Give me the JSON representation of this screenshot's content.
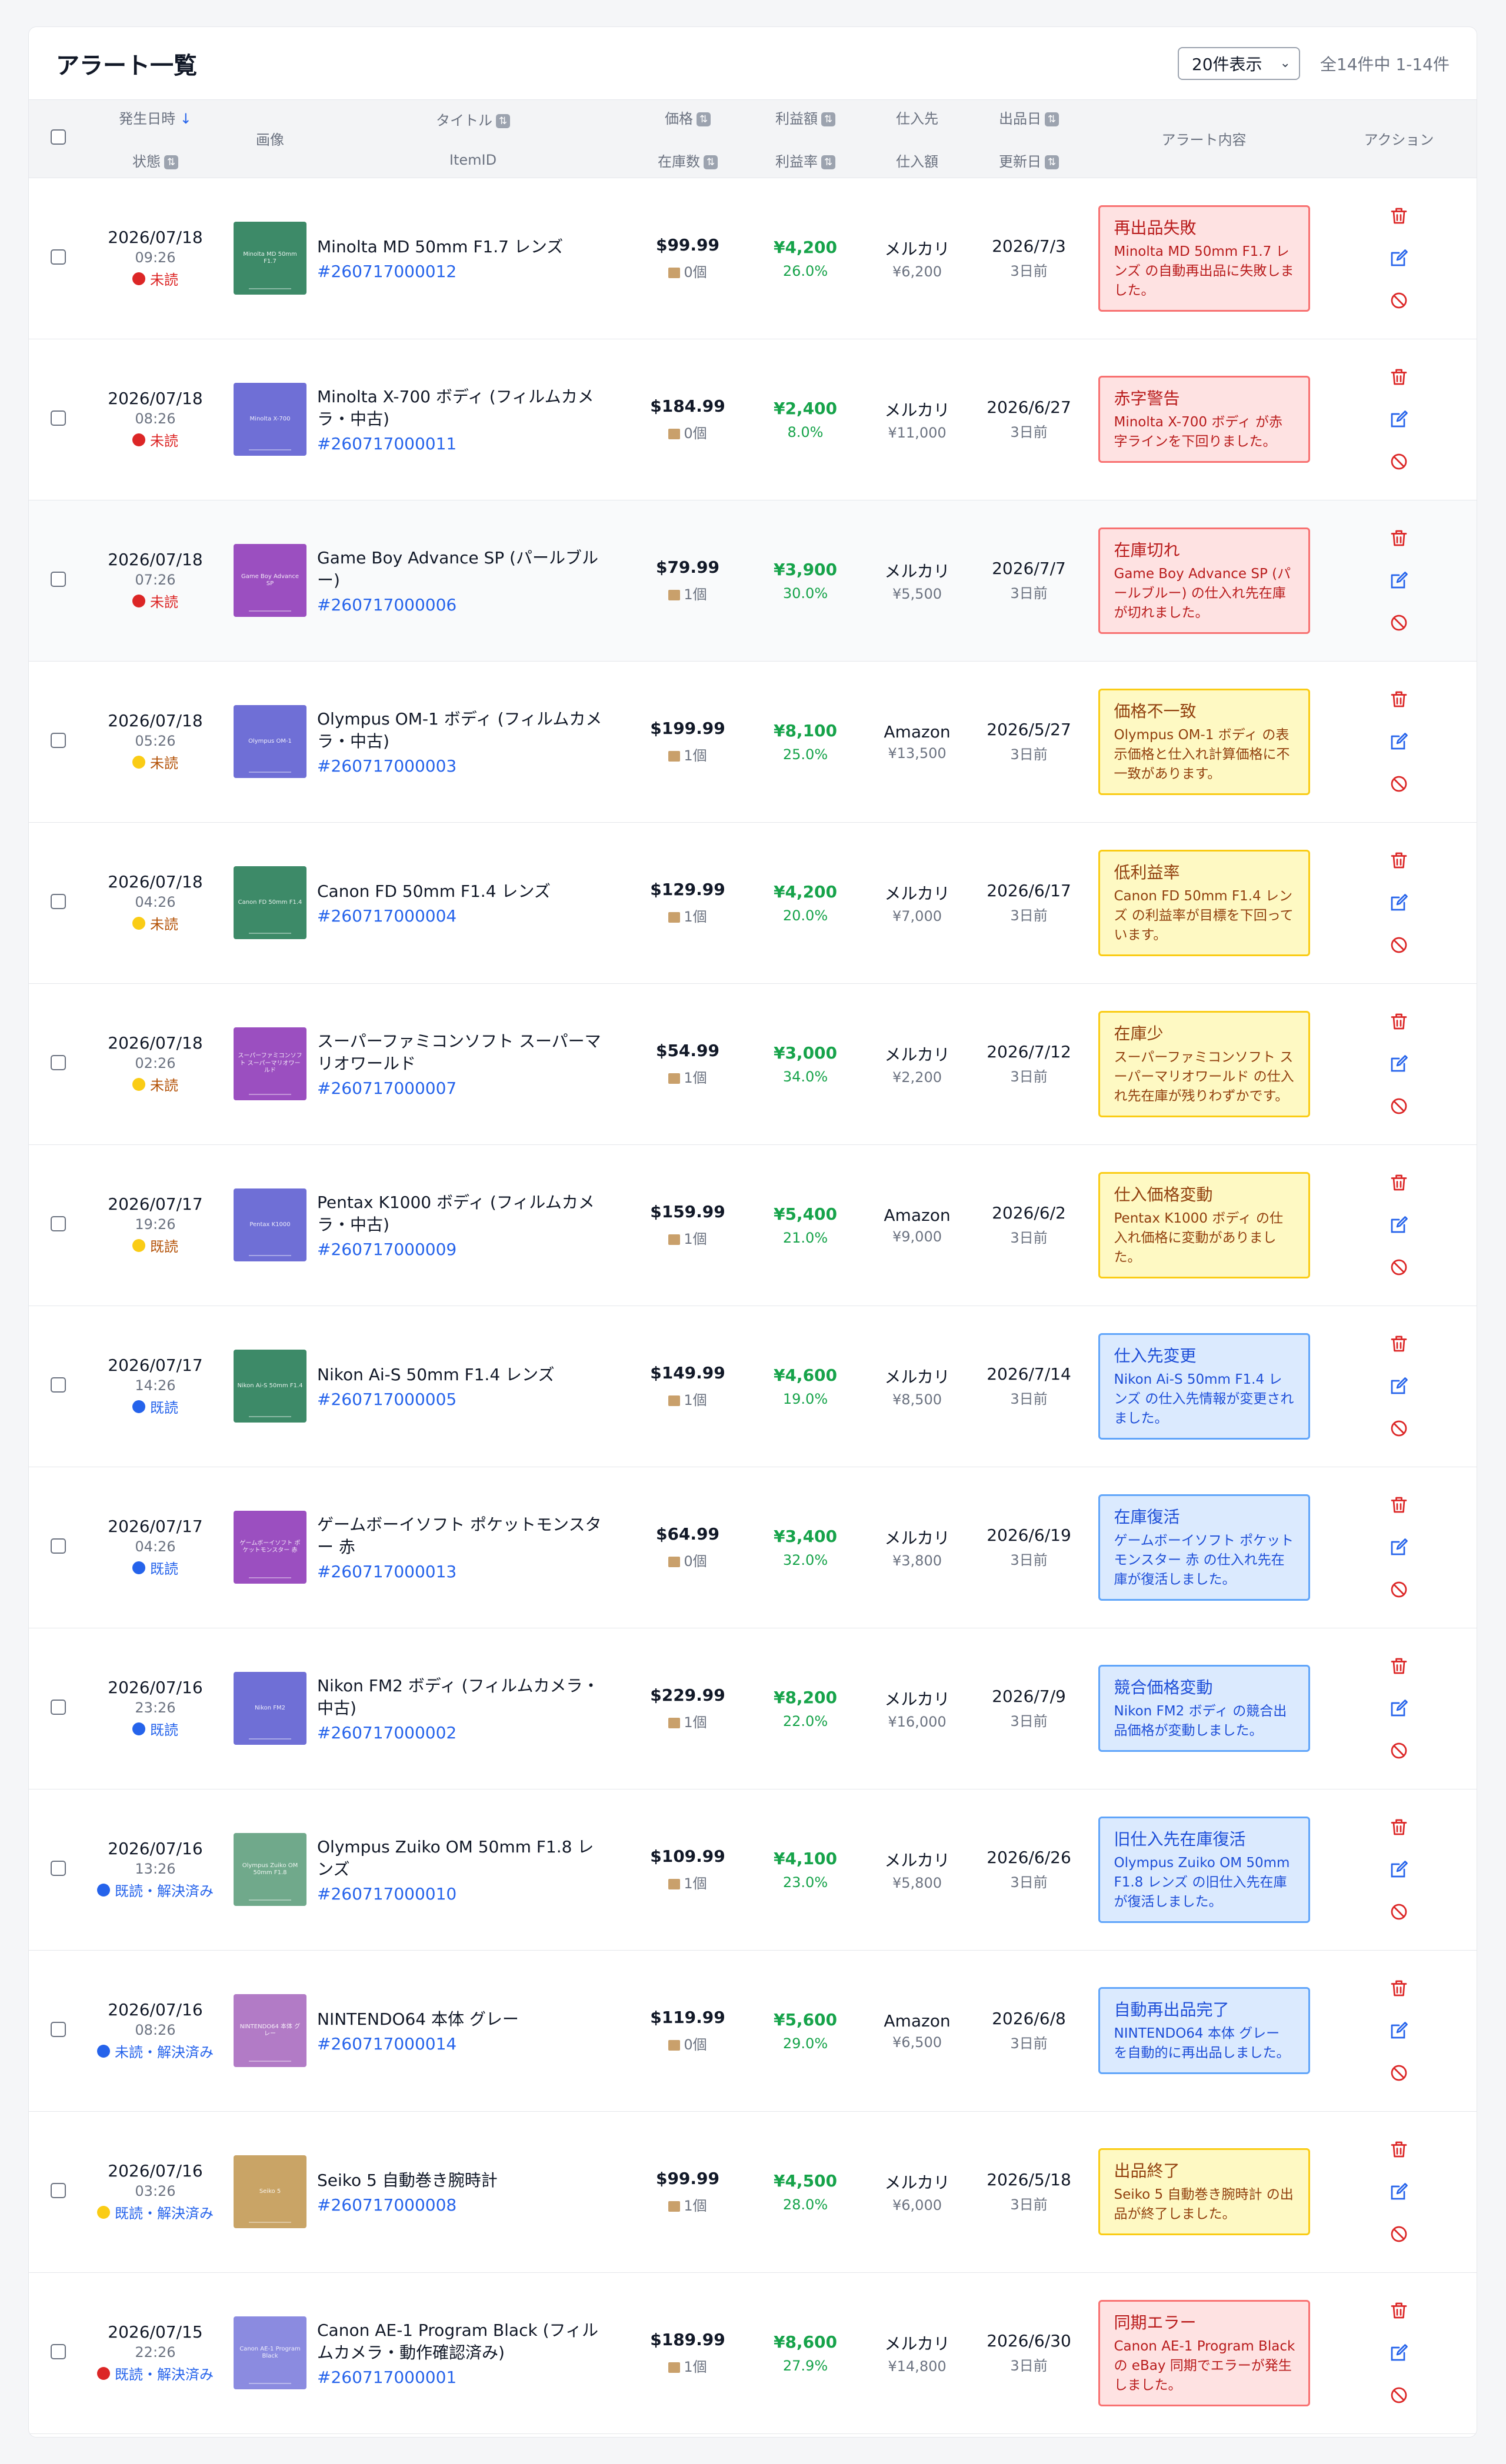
{
  "panel": {
    "title": "アラート一覧",
    "per_page": "20件表示",
    "count": "全14件中 1-14件"
  },
  "columns": {
    "occurred": "発生日時",
    "occurred_sort": "↓",
    "status": "状態",
    "image": "画像",
    "title": "タイトル",
    "itemid": "ItemID",
    "price": "価格",
    "stock": "在庫数",
    "profit": "利益額",
    "rate": "利益率",
    "source": "仕入先",
    "cost": "仕入額",
    "listed": "出品日",
    "updated": "更新日",
    "alert": "アラート内容",
    "action": "アクション"
  },
  "colors": {
    "red": "#dc2626",
    "yellow": "#facc15",
    "blue": "#2563eb",
    "unread_text": "#dc2626",
    "yellow_text": "#b45309",
    "blue_text": "#2563eb"
  },
  "rows": [
    {
      "date": "2026/07/18",
      "time": "09:26",
      "status": "未読",
      "dot": "red",
      "thumb_color": "#3d8a68",
      "thumb_label": "Minolta MD 50mm F1.7",
      "title": "Minolta MD 50mm F1.7 レンズ",
      "itemid": "#260717000012",
      "price": "$99.99",
      "stock": "0個",
      "profit": "¥4,200",
      "rate": "26.0%",
      "source": "メルカリ",
      "cost": "¥6,200",
      "listed": "2026/7/3",
      "updated": "3日前",
      "alert_level": "red",
      "alert_title": "再出品失敗",
      "alert_body": "Minolta MD 50mm F1.7 レンズ の自動再出品に失敗しました。",
      "highlight": false
    },
    {
      "date": "2026/07/18",
      "time": "08:26",
      "status": "未読",
      "dot": "red",
      "thumb_color": "#6f6fd6",
      "thumb_label": "Minolta X-700",
      "title": "Minolta X-700 ボディ (フィルムカメラ・中古)",
      "itemid": "#260717000011",
      "price": "$184.99",
      "stock": "0個",
      "profit": "¥2,400",
      "rate": "8.0%",
      "source": "メルカリ",
      "cost": "¥11,000",
      "listed": "2026/6/27",
      "updated": "3日前",
      "alert_level": "red",
      "alert_title": "赤字警告",
      "alert_body": "Minolta X-700 ボディ が赤字ラインを下回りました。",
      "highlight": false
    },
    {
      "date": "2026/07/18",
      "time": "07:26",
      "status": "未読",
      "dot": "red",
      "thumb_color": "#9b4fc0",
      "thumb_label": "Game Boy Advance SP",
      "title": "Game Boy Advance SP (パールブルー)",
      "itemid": "#260717000006",
      "price": "$79.99",
      "stock": "1個",
      "profit": "¥3,900",
      "rate": "30.0%",
      "source": "メルカリ",
      "cost": "¥5,500",
      "listed": "2026/7/7",
      "updated": "3日前",
      "alert_level": "red",
      "alert_title": "在庫切れ",
      "alert_body": "Game Boy Advance SP (パールブルー) の仕入れ先在庫が切れました。",
      "highlight": true
    },
    {
      "date": "2026/07/18",
      "time": "05:26",
      "status": "未読",
      "dot": "yellow",
      "thumb_color": "#6f6fd6",
      "thumb_label": "Olympus OM-1",
      "title": "Olympus OM-1 ボディ (フィルムカメラ・中古)",
      "itemid": "#260717000003",
      "price": "$199.99",
      "stock": "1個",
      "profit": "¥8,100",
      "rate": "25.0%",
      "source": "Amazon",
      "cost": "¥13,500",
      "listed": "2026/5/27",
      "updated": "3日前",
      "alert_level": "yellow",
      "alert_title": "価格不一致",
      "alert_body": "Olympus OM-1 ボディ の表示価格と仕入れ計算価格に不一致があります。",
      "highlight": false
    },
    {
      "date": "2026/07/18",
      "time": "04:26",
      "status": "未読",
      "dot": "yellow",
      "thumb_color": "#3d8a68",
      "thumb_label": "Canon FD 50mm F1.4",
      "title": "Canon FD 50mm F1.4 レンズ",
      "itemid": "#260717000004",
      "price": "$129.99",
      "stock": "1個",
      "profit": "¥4,200",
      "rate": "20.0%",
      "source": "メルカリ",
      "cost": "¥7,000",
      "listed": "2026/6/17",
      "updated": "3日前",
      "alert_level": "yellow",
      "alert_title": "低利益率",
      "alert_body": "Canon FD 50mm F1.4 レンズ の利益率が目標を下回っています。",
      "highlight": false
    },
    {
      "date": "2026/07/18",
      "time": "02:26",
      "status": "未読",
      "dot": "yellow",
      "thumb_color": "#9b4fc0",
      "thumb_label": "スーパーファミコンソフト スーパーマリオワールド",
      "title": "スーパーファミコンソフト スーパーマリオワールド",
      "itemid": "#260717000007",
      "price": "$54.99",
      "stock": "1個",
      "profit": "¥3,000",
      "rate": "34.0%",
      "source": "メルカリ",
      "cost": "¥2,200",
      "listed": "2026/7/12",
      "updated": "3日前",
      "alert_level": "yellow",
      "alert_title": "在庫少",
      "alert_body": "スーパーファミコンソフト スーパーマリオワールド の仕入れ先在庫が残りわずかです。",
      "highlight": false
    },
    {
      "date": "2026/07/17",
      "time": "19:26",
      "status": "既読",
      "dot": "yellow",
      "thumb_color": "#6f6fd6",
      "thumb_label": "Pentax K1000",
      "title": "Pentax K1000 ボディ (フィルムカメラ・中古)",
      "itemid": "#260717000009",
      "price": "$159.99",
      "stock": "1個",
      "profit": "¥5,400",
      "rate": "21.0%",
      "source": "Amazon",
      "cost": "¥9,000",
      "listed": "2026/6/2",
      "updated": "3日前",
      "alert_level": "yellow",
      "alert_title": "仕入価格変動",
      "alert_body": "Pentax K1000 ボディ の仕入れ価格に変動がありました。",
      "highlight": false
    },
    {
      "date": "2026/07/17",
      "time": "14:26",
      "status": "既読",
      "dot": "blue",
      "thumb_color": "#3d8a68",
      "thumb_label": "Nikon Ai-S 50mm F1.4",
      "title": "Nikon Ai-S 50mm F1.4 レンズ",
      "itemid": "#260717000005",
      "price": "$149.99",
      "stock": "1個",
      "profit": "¥4,600",
      "rate": "19.0%",
      "source": "メルカリ",
      "cost": "¥8,500",
      "listed": "2026/7/14",
      "updated": "3日前",
      "alert_level": "blue",
      "alert_title": "仕入先変更",
      "alert_body": "Nikon Ai-S 50mm F1.4 レンズ の仕入先情報が変更されました。",
      "highlight": false
    },
    {
      "date": "2026/07/17",
      "time": "04:26",
      "status": "既読",
      "dot": "blue",
      "thumb_color": "#9b4fc0",
      "thumb_label": "ゲームボーイソフト ポケットモンスター 赤",
      "title": "ゲームボーイソフト ポケットモンスター 赤",
      "itemid": "#260717000013",
      "price": "$64.99",
      "stock": "0個",
      "profit": "¥3,400",
      "rate": "32.0%",
      "source": "メルカリ",
      "cost": "¥3,800",
      "listed": "2026/6/19",
      "updated": "3日前",
      "alert_level": "blue",
      "alert_title": "在庫復活",
      "alert_body": "ゲームボーイソフト ポケットモンスター 赤 の仕入れ先在庫が復活しました。",
      "highlight": false
    },
    {
      "date": "2026/07/16",
      "time": "23:26",
      "status": "既読",
      "dot": "blue",
      "thumb_color": "#6f6fd6",
      "thumb_label": "Nikon FM2",
      "title": "Nikon FM2 ボディ (フィルムカメラ・中古)",
      "itemid": "#260717000002",
      "price": "$229.99",
      "stock": "1個",
      "profit": "¥8,200",
      "rate": "22.0%",
      "source": "メルカリ",
      "cost": "¥16,000",
      "listed": "2026/7/9",
      "updated": "3日前",
      "alert_level": "blue",
      "alert_title": "競合価格変動",
      "alert_body": "Nikon FM2 ボディ の競合出品価格が変動しました。",
      "highlight": false
    },
    {
      "date": "2026/07/16",
      "time": "13:26",
      "status": "既読・解決済み",
      "dot": "blue",
      "thumb_color": "#70a98b",
      "thumb_label": "Olympus Zuiko OM 50mm F1.8",
      "title": "Olympus Zuiko OM 50mm F1.8 レンズ",
      "itemid": "#260717000010",
      "price": "$109.99",
      "stock": "1個",
      "profit": "¥4,100",
      "rate": "23.0%",
      "source": "メルカリ",
      "cost": "¥5,800",
      "listed": "2026/6/26",
      "updated": "3日前",
      "alert_level": "blue",
      "alert_title": "旧仕入先在庫復活",
      "alert_body": "Olympus Zuiko OM 50mm F1.8 レンズ の旧仕入先在庫が復活しました。",
      "highlight": false
    },
    {
      "date": "2026/07/16",
      "time": "08:26",
      "status": "未読・解決済み",
      "dot": "blue",
      "thumb_color": "#b27bc6",
      "thumb_label": "NINTENDO64 本体 グレー",
      "title": "NINTENDO64 本体 グレー",
      "itemid": "#260717000014",
      "price": "$119.99",
      "stock": "0個",
      "profit": "¥5,600",
      "rate": "29.0%",
      "source": "Amazon",
      "cost": "¥6,500",
      "listed": "2026/6/8",
      "updated": "3日前",
      "alert_level": "blue",
      "alert_title": "自動再出品完了",
      "alert_body": "NINTENDO64 本体 グレー を自動的に再出品しました。",
      "highlight": false
    },
    {
      "date": "2026/07/16",
      "time": "03:26",
      "status": "既読・解決済み",
      "dot": "yellow",
      "thumb_color": "#c9a466",
      "thumb_label": "Seiko 5",
      "title": "Seiko 5 自動巻き腕時計",
      "itemid": "#260717000008",
      "price": "$99.99",
      "stock": "1個",
      "profit": "¥4,500",
      "rate": "28.0%",
      "source": "メルカリ",
      "cost": "¥6,000",
      "listed": "2026/5/18",
      "updated": "3日前",
      "alert_level": "yellow",
      "alert_title": "出品終了",
      "alert_body": "Seiko 5 自動巻き腕時計 の出品が終了しました。",
      "highlight": false
    },
    {
      "date": "2026/07/15",
      "time": "22:26",
      "status": "既読・解決済み",
      "dot": "red",
      "thumb_color": "#8b8be0",
      "thumb_label": "Canon AE-1 Program Black",
      "title": "Canon AE-1 Program Black (フィルムカメラ・動作確認済み)",
      "itemid": "#260717000001",
      "price": "$189.99",
      "stock": "1個",
      "profit": "¥8,600",
      "rate": "27.9%",
      "source": "メルカリ",
      "cost": "¥14,800",
      "listed": "2026/6/30",
      "updated": "3日前",
      "alert_level": "red",
      "alert_title": "同期エラー",
      "alert_body": "Canon AE-1 Program Black の eBay 同期でエラーが発生しました。",
      "highlight": false
    }
  ]
}
